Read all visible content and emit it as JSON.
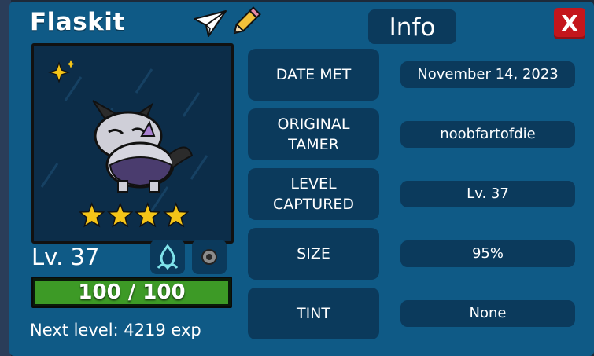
{
  "creature": {
    "name": "Flaskit",
    "level_text": "Lv. 37",
    "star_count": 4,
    "hp_text": "100 / 100",
    "hp_fraction": 1.0,
    "next_level_text": "Next level: 4219 exp"
  },
  "tab": {
    "label": "Info"
  },
  "close": {
    "label": "X"
  },
  "icons": {
    "share": "paper-plane-icon",
    "rename": "pencil-icon",
    "shiny": "sparkle-icon",
    "type": "water-type-icon",
    "ability": "ability-icon"
  },
  "info_rows": [
    {
      "label": "DATE MET",
      "value": "November 14, 2023"
    },
    {
      "label": "ORIGINAL\nTAMER",
      "value": "noobfartofdie"
    },
    {
      "label": "LEVEL\nCAPTURED",
      "value": "Lv. 37"
    },
    {
      "label": "SIZE",
      "value": "95%"
    },
    {
      "label": "TINT",
      "value": "None"
    }
  ],
  "colors": {
    "panel": "#0f5a86",
    "box": "#0b3a5c",
    "close": "#c4161c",
    "star": "#f5c518",
    "hp_fill": "#3d9a26"
  }
}
